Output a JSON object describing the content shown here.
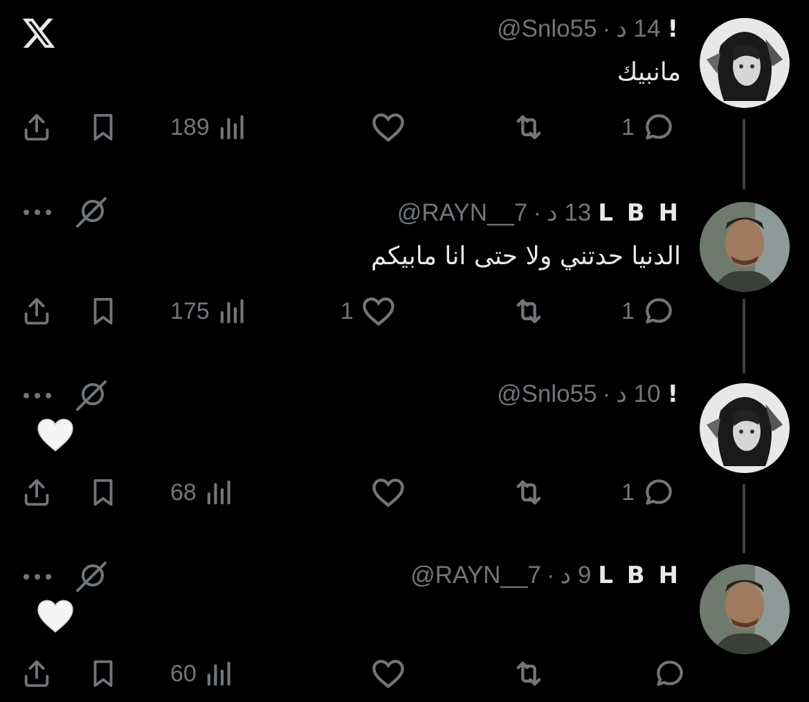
{
  "app": {
    "logo": "x-logo-icon"
  },
  "tweets": [
    {
      "name": "!",
      "handle": "@Snlo55",
      "dot": "·",
      "time": "14 د",
      "text": "مانبيك",
      "replies": "1",
      "retweets": "",
      "likes": "",
      "views": "189",
      "avatar": "avatar-snlo55",
      "has_more_menu": false,
      "has_emoji": false
    },
    {
      "name": "L B H",
      "handle": "@RAYN__7",
      "dot": "·",
      "time": "13 د",
      "text": "الدنيا حدتني ولا حتى انا مابيكم",
      "replies": "1",
      "retweets": "",
      "likes": "1",
      "views": "175",
      "avatar": "avatar-rayn7",
      "has_more_menu": true,
      "has_emoji": false
    },
    {
      "name": "!",
      "handle": "@Snlo55",
      "dot": "·",
      "time": "10 د",
      "text": "🤍",
      "replies": "1",
      "retweets": "",
      "likes": "",
      "views": "68",
      "avatar": "avatar-snlo55",
      "has_more_menu": true,
      "has_emoji": true
    },
    {
      "name": "L B H",
      "handle": "@RAYN__7",
      "dot": "·",
      "time": "9 د",
      "text": "🤍",
      "replies": "",
      "retweets": "",
      "likes": "",
      "views": "60",
      "avatar": "avatar-rayn7",
      "has_more_menu": true,
      "has_emoji": true
    }
  ],
  "colors": {
    "background": "#000000",
    "text": "#e7e9ea",
    "muted": "#71767b",
    "thread_line": "#3e4144"
  }
}
